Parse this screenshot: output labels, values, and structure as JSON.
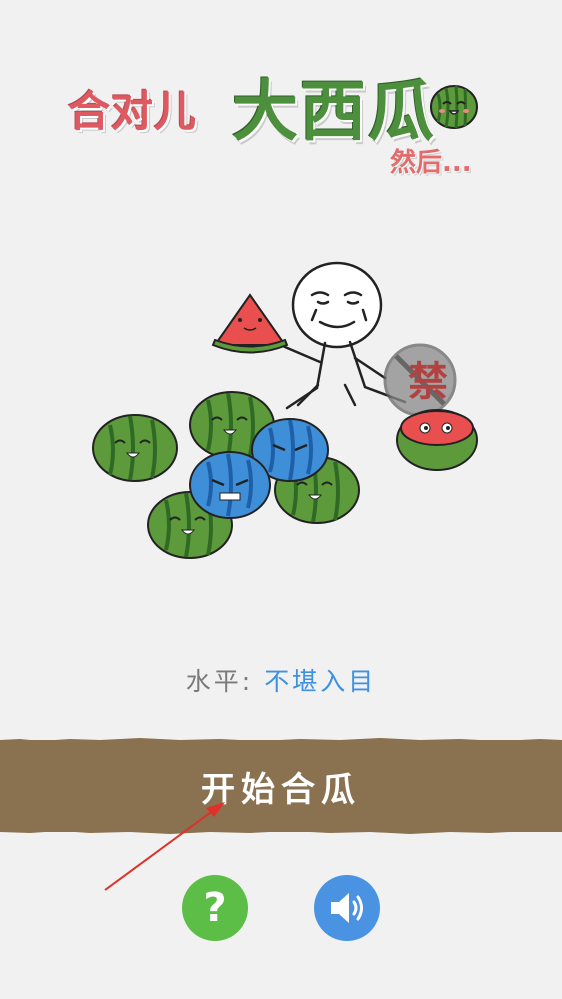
{
  "title": {
    "part1": "合对儿",
    "part2": "大西瓜",
    "subtitle": "然后..."
  },
  "level": {
    "label": "水平:",
    "value": "不堪入目"
  },
  "start_button": {
    "label": "开始合瓜"
  },
  "help_button": {
    "label": "?"
  },
  "ban_sign": {
    "text": "禁"
  },
  "icons": {
    "help": "question-mark-icon",
    "sound": "speaker-icon"
  },
  "colors": {
    "background": "#f1f1f1",
    "bar": "#8a7150",
    "help": "#5cbe46",
    "sound": "#4a93e3",
    "level_value": "#3d91e3"
  }
}
